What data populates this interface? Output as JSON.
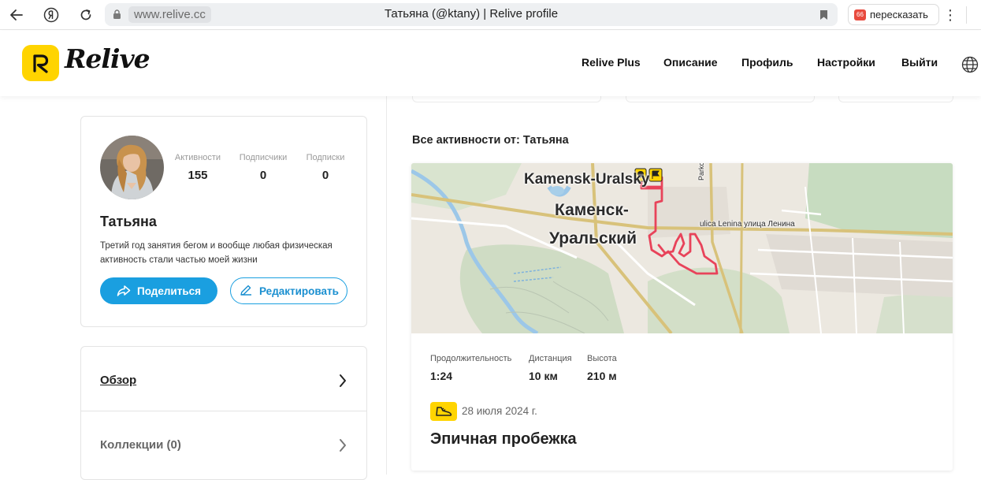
{
  "browser": {
    "url_domain": "www.relive.cc",
    "tab_title": "Татьяна (@ktany) | Relive profile",
    "retell_label": "пересказать",
    "retell_icon_text": "66"
  },
  "header": {
    "logo_text": "Relive",
    "nav": [
      "Relive Plus",
      "Описание",
      "Профиль",
      "Настройки",
      "Выйти"
    ]
  },
  "profile": {
    "name": "Татьяна",
    "bio": "Третий год занятия бегом и вообще любая физическая активность стали частью моей жизни",
    "stats": [
      {
        "label": "Активности",
        "value": "155"
      },
      {
        "label": "Подписчики",
        "value": "0"
      },
      {
        "label": "Подписки",
        "value": "0"
      }
    ],
    "share_label": "Поделиться",
    "edit_label": "Редактировать"
  },
  "menu": {
    "overview_label": "Обзор",
    "collections_label": "Коллекции",
    "collections_count": "(0)"
  },
  "activities": {
    "section_title": "Все активности от: Татьяна",
    "item": {
      "map_labels": {
        "city_en": "Kamensk-Uralsky",
        "city_ru_1": "Каменск-",
        "city_ru_2": "Уральский",
        "street": "ulica Lenina улица Ленина",
        "park": "Parkova"
      },
      "metrics": [
        {
          "label": "Продолжительность",
          "value": "1:24"
        },
        {
          "label": "Дистанция",
          "value": "10 км"
        },
        {
          "label": "Высота",
          "value": "210 м"
        }
      ],
      "date": "28 июля 2024 г.",
      "title": "Эпичная пробежка"
    }
  },
  "colors": {
    "brand_yellow": "#ffd400",
    "accent_blue": "#1a9fe0",
    "route_red": "#e8435a"
  }
}
